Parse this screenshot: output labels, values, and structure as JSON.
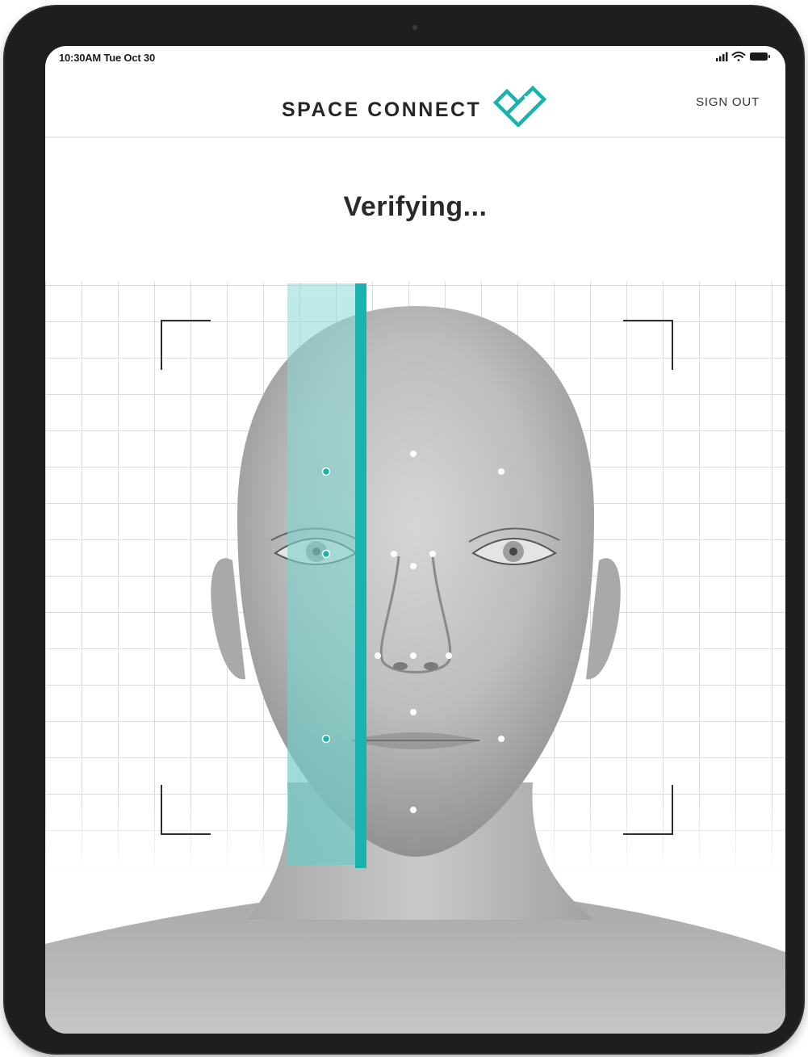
{
  "status_bar": {
    "time": "10:30AM Tue Oct 30",
    "icons": [
      "signal-icon",
      "wifi-icon",
      "battery-icon"
    ]
  },
  "header": {
    "app_title": "SPACE CONNECT",
    "sign_out_label": "SIGN OUT",
    "logo": "space-connect-logo"
  },
  "main": {
    "status_heading": "Verifying..."
  },
  "scan": {
    "progress": 0.48
  },
  "colors": {
    "accent": "#19b2ad",
    "scan_tint": "#7fd3cf",
    "text": "#2a2a2a",
    "grid": "#dcdcdc",
    "device_frame": "#1d1e20"
  }
}
